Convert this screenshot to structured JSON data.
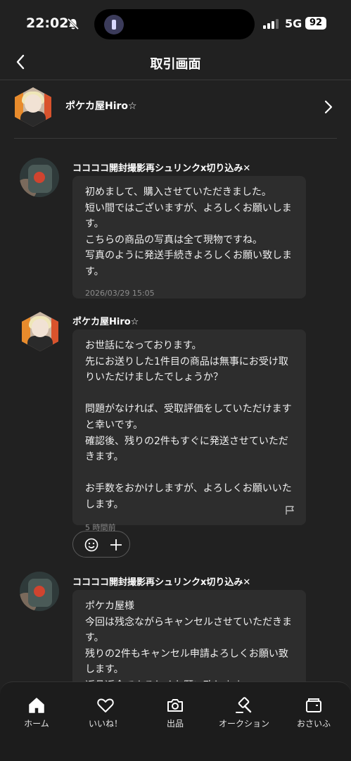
{
  "status": {
    "time": "22:02",
    "network": "5G",
    "battery": "92"
  },
  "header": {
    "title": "取引画面"
  },
  "seller": {
    "name": "ポケカ屋Hiro☆"
  },
  "messages": [
    {
      "sender": "ココココ開封撮影再シュリンクx切り込み✕",
      "text": "初めまして、購入させていただきました。\n短い間ではございますが、よろしくお願いします。\nこちらの商品の写真は全て現物ですね。\n写真のように発送手続きよろしくお願い致します。",
      "time": "2026/03/29 15:05"
    },
    {
      "sender": "ポケカ屋Hiro☆",
      "text": "お世話になっております。\n先にお送りした1件目の商品は無事にお受け取りいただけましたでしょうか？\n\n問題がなければ、受取評価をしていただけますと幸いです。\n確認後、残りの2件もすぐに発送させていただきます。\n\nお手数をおかけしますが、よろしくお願いいたします。",
      "time": "5 時間前"
    },
    {
      "sender": "ココココ開封撮影再シュリンクx切り込み✕",
      "text": "ポケカ屋様\n今回は残念ながらキャンセルさせていただきます。\n残りの2件もキャンセル申請よろしくお願い致します。\n返品返金でよろしくお願い致します。"
    }
  ],
  "tabs": [
    {
      "label": "ホーム",
      "icon": "home-icon"
    },
    {
      "label": "いいね！",
      "icon": "heart-icon"
    },
    {
      "label": "出品",
      "icon": "camera-icon"
    },
    {
      "label": "オークション",
      "icon": "gavel-icon"
    },
    {
      "label": "おさいふ",
      "icon": "wallet-icon"
    }
  ]
}
